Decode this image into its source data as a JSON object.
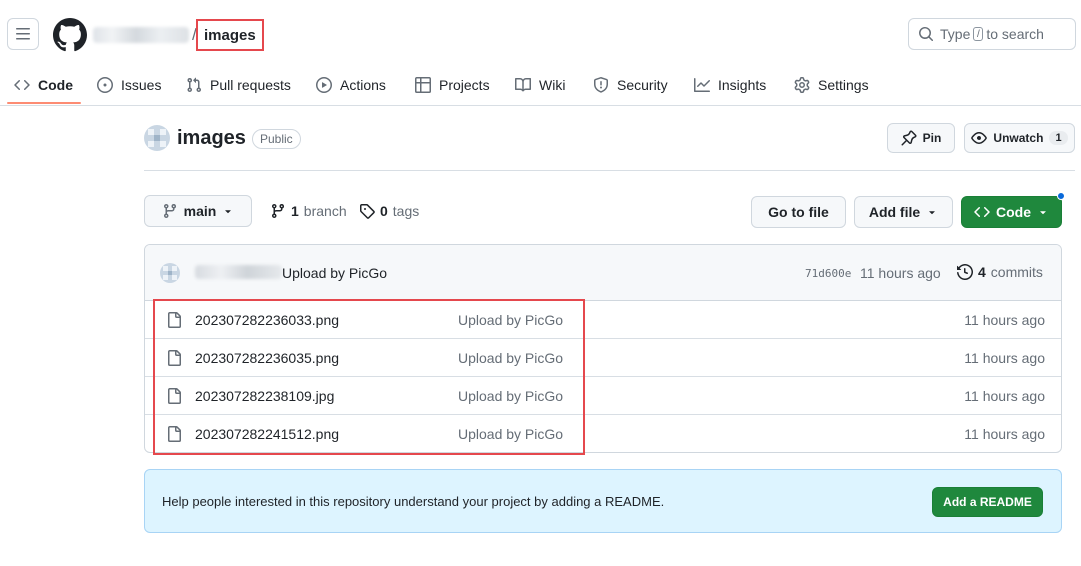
{
  "header": {
    "repo_crumb": "images",
    "slash": "/",
    "search": {
      "prefix": "Type",
      "key": "/",
      "suffix": "to search"
    }
  },
  "tabs": [
    {
      "label": "Code",
      "icon": "code-icon",
      "active": true
    },
    {
      "label": "Issues",
      "icon": "issue-icon"
    },
    {
      "label": "Pull requests",
      "icon": "pull-request-icon"
    },
    {
      "label": "Actions",
      "icon": "play-icon"
    },
    {
      "label": "Projects",
      "icon": "table-icon"
    },
    {
      "label": "Wiki",
      "icon": "book-icon"
    },
    {
      "label": "Security",
      "icon": "shield-icon"
    },
    {
      "label": "Insights",
      "icon": "graph-icon"
    },
    {
      "label": "Settings",
      "icon": "gear-icon"
    }
  ],
  "repo": {
    "name": "images",
    "visibility": "Public",
    "pin_label": "Pin",
    "watch_label": "Unwatch",
    "watch_count": "1"
  },
  "branch": {
    "current": "main",
    "branch_count": "1",
    "branch_label": "branch",
    "tag_count": "0",
    "tag_label": "tags"
  },
  "actions": {
    "go_to_file": "Go to file",
    "add_file": "Add file",
    "code": "Code"
  },
  "latest_commit": {
    "message": "Upload by PicGo",
    "sha": "71d600e",
    "time": "11 hours ago",
    "commit_count": "4",
    "commits_label": "commits"
  },
  "files": [
    {
      "name": "202307282236033.png",
      "commit": "Upload by PicGo",
      "time": "11 hours ago"
    },
    {
      "name": "202307282236035.png",
      "commit": "Upload by PicGo",
      "time": "11 hours ago"
    },
    {
      "name": "202307282238109.jpg",
      "commit": "Upload by PicGo",
      "time": "11 hours ago"
    },
    {
      "name": "202307282241512.png",
      "commit": "Upload by PicGo",
      "time": "11 hours ago"
    }
  ],
  "readme": {
    "message": "Help people interested in this repository understand your project by adding a README.",
    "button": "Add a README"
  },
  "colors": {
    "primary_green": "#1f883d",
    "annotation_red": "#e5484d",
    "active_tab_underline": "#fd8c73",
    "readme_banner_bg": "#ddf4ff"
  }
}
